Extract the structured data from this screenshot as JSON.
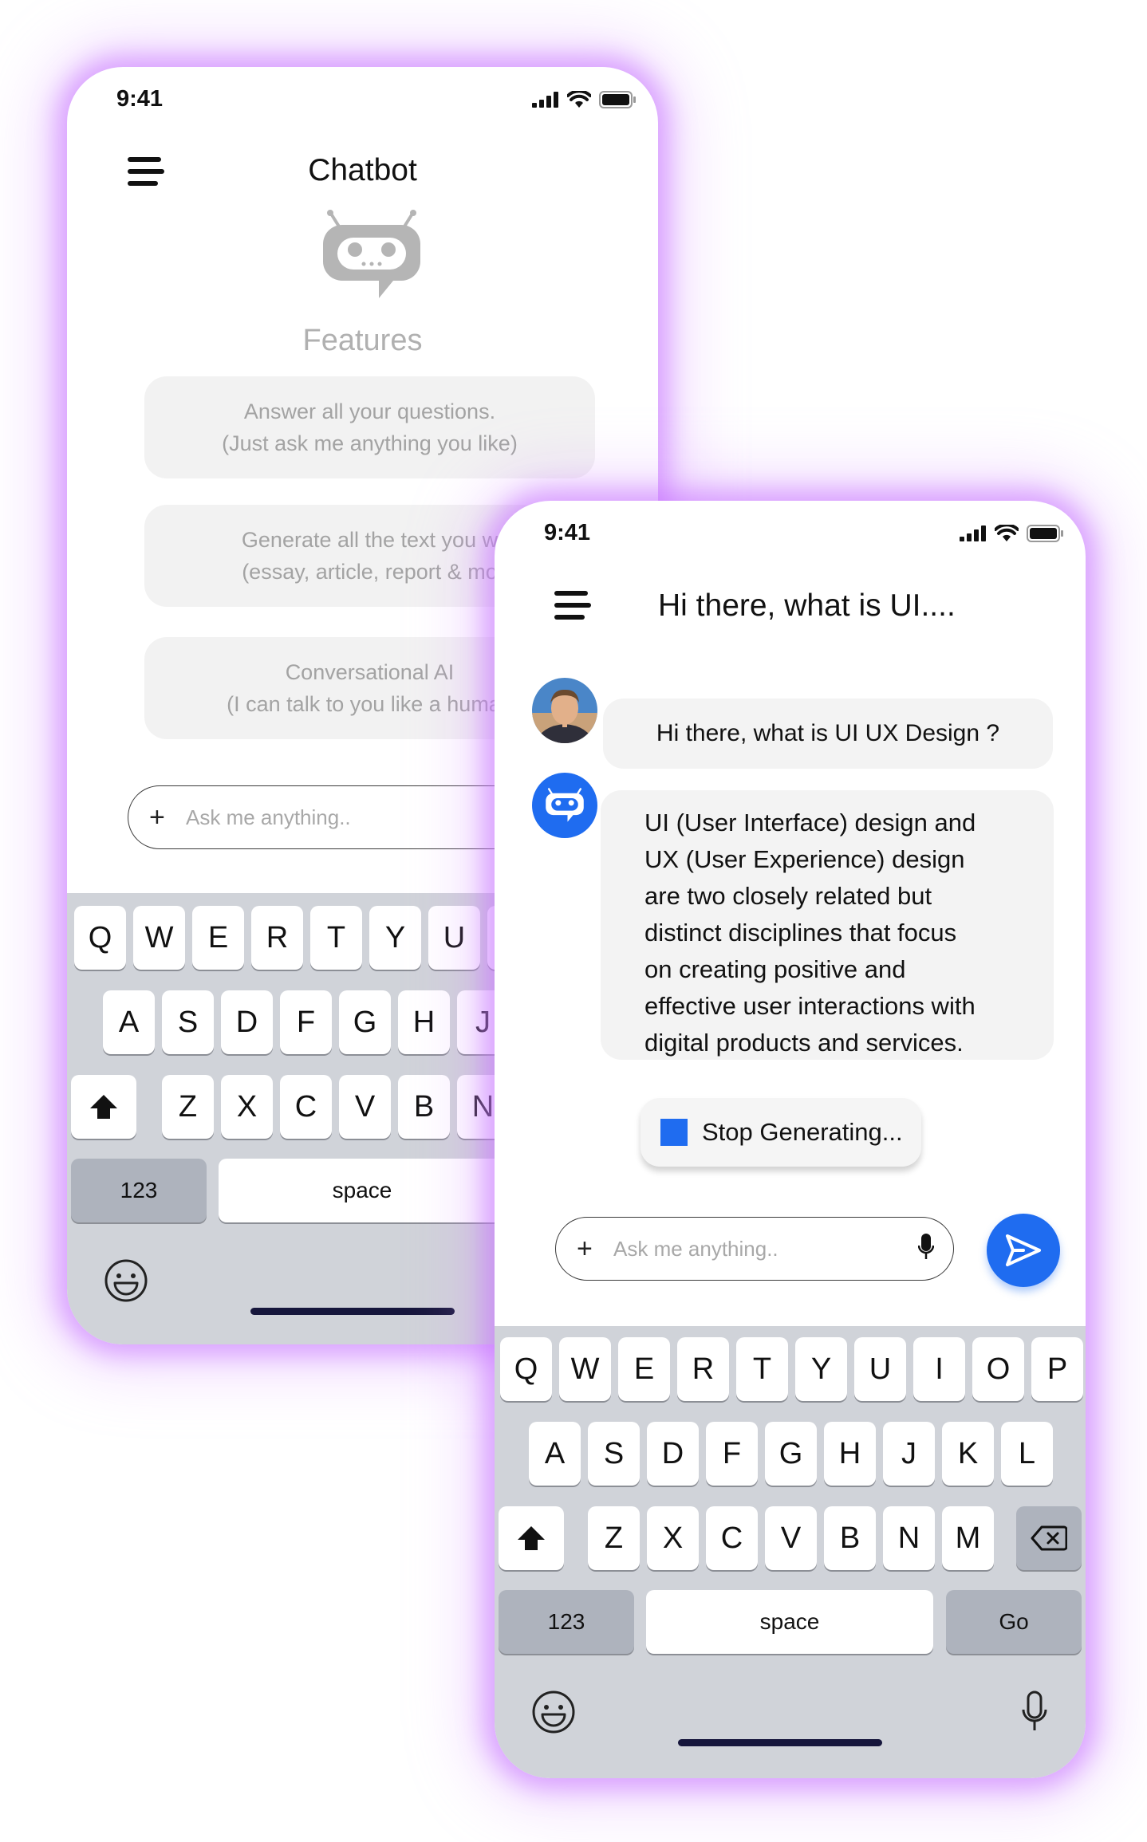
{
  "status_bar": {
    "time": "9:41"
  },
  "left_screen": {
    "title": "Chatbot",
    "features_heading": "Features",
    "features": [
      {
        "line1": "Answer all your questions.",
        "line2": "(Just ask me anything you like)"
      },
      {
        "line1": "Generate all the text you w",
        "line2": "(essay, article, report & mo"
      },
      {
        "line1": "Conversational AI",
        "line2": "(I can talk to you like a human"
      }
    ],
    "input": {
      "plus": "+",
      "placeholder": "Ask me anything.."
    },
    "keyboard": {
      "row1": [
        "Q",
        "W",
        "E",
        "R",
        "T",
        "Y",
        "U"
      ],
      "row2": [
        "A",
        "S",
        "D",
        "F",
        "G",
        "H",
        "J"
      ],
      "row3": [
        "Z",
        "X",
        "C",
        "V",
        "B",
        "N"
      ],
      "numbers_key": "123",
      "space_key": "space"
    }
  },
  "right_screen": {
    "title": "Hi there, what is UI....",
    "user_message": "Hi there, what is UI UX Design ?",
    "bot_message_lines": [
      "UI (User Interface) design and",
      "UX (User Experience) design",
      "are two closely related but",
      "distinct disciplines that focus",
      "on creating positive and",
      "effective user interactions with",
      "digital products and services."
    ],
    "stop_button": "Stop Generating...",
    "input": {
      "plus": "+",
      "placeholder": "Ask me anything.."
    },
    "keyboard": {
      "row1": [
        "Q",
        "W",
        "E",
        "R",
        "T",
        "Y",
        "U",
        "I",
        "O",
        "P"
      ],
      "row2": [
        "A",
        "S",
        "D",
        "F",
        "G",
        "H",
        "J",
        "K",
        "L"
      ],
      "row3": [
        "Z",
        "X",
        "C",
        "V",
        "B",
        "N",
        "M"
      ],
      "numbers_key": "123",
      "space_key": "space",
      "go_key": "Go"
    }
  },
  "icons": {
    "menu": "hamburger-menu-icon",
    "bot": "robot-chat-icon",
    "mic": "microphone-icon",
    "send": "send-icon",
    "shift": "shift-arrow-icon",
    "backspace": "backspace-icon",
    "emoji": "emoji-icon",
    "signal": "cellular-signal-icon",
    "wifi": "wifi-icon",
    "battery": "battery-icon"
  },
  "colors": {
    "accent": "#1f6cf0",
    "glow": "#c470ff",
    "keyboard_bg": "#d0d3d9",
    "home_indicator": "#16163c"
  }
}
